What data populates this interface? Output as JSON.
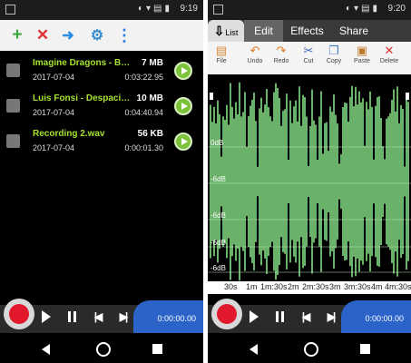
{
  "status_left": {
    "time": "9:19"
  },
  "status_right": {
    "time": "9:20"
  },
  "left_toolbar": {
    "add": "+",
    "delete": "✕",
    "move": "➜",
    "settings": "⚙",
    "more": "⋮"
  },
  "records": [
    {
      "name": "Imagine Dragons - Believe…",
      "date": "2017-07-04",
      "size": "7 MB",
      "duration": "0:03:22.95"
    },
    {
      "name": "Luis Fonsi - Despacito ft. …",
      "date": "2017-07-04",
      "size": "10 MB",
      "duration": "0:04:40.94"
    },
    {
      "name": "Recording 2.wav",
      "date": "2017-07-04",
      "size": "56 KB",
      "duration": "0:00:01.30"
    }
  ],
  "player": {
    "time": "0:00:00.00"
  },
  "tabs": {
    "list": "List",
    "edit": "Edit",
    "effects": "Effects",
    "share": "Share"
  },
  "edit_tools": [
    {
      "label": "File",
      "icon": "file-icon"
    },
    {
      "label": "Undo",
      "icon": "undo-icon"
    },
    {
      "label": "Redo",
      "icon": "redo-icon"
    },
    {
      "label": "Cut",
      "icon": "cut-icon"
    },
    {
      "label": "Copy",
      "icon": "copy-icon"
    },
    {
      "label": "Paste",
      "icon": "paste-icon"
    },
    {
      "label": "Delete",
      "icon": "delete-icon"
    }
  ],
  "waveform": {
    "db_labels": [
      "0dB",
      "-6dB",
      "-6dB",
      "-6dB",
      "-6dB"
    ],
    "time_ticks": [
      "30s",
      "1m",
      "1m:30s",
      "2m",
      "2m:30s",
      "3m",
      "3m:30s",
      "4m",
      "4m:30s"
    ],
    "wave_color": "#6ab26a"
  },
  "colors": {
    "accent_green": "#a6e22e",
    "record_red": "#e2182d",
    "time_blue": "#2b63c9"
  }
}
